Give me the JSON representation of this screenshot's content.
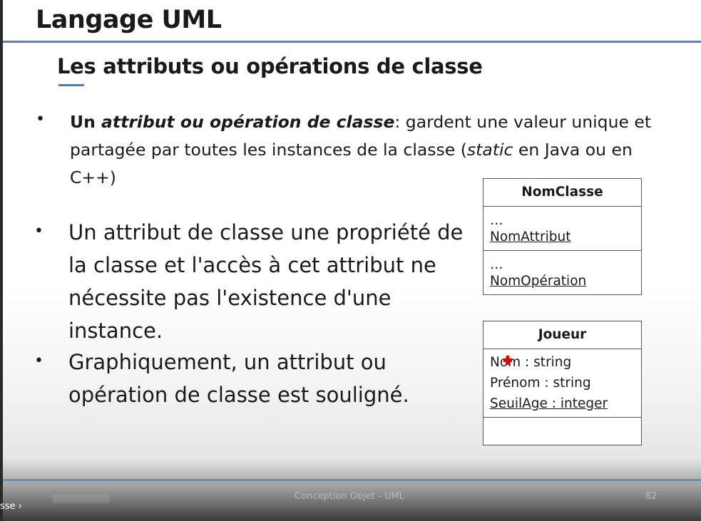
{
  "slide": {
    "title": "Langage UML",
    "subtitle": "Les attributs ou opérations de classe",
    "bullet_glyph": "•",
    "bullet1": {
      "bold_start": "Un ",
      "bold_italic": "attribut ou opération de classe",
      "rest_a": ": gardent une valeur unique et partagée par toutes les instances de la classe (",
      "italic": "static",
      "rest_b": " en Java ou en C++)"
    },
    "bullet2": "Un attribut de classe une propriété de la classe et l'accès à cet attribut ne nécessite pas l'existence d'une instance.",
    "bullet3": "Graphiquement, un attribut ou opération de classe est souligné."
  },
  "uml_nomclasse": {
    "name": "NomClasse",
    "attr_ellipsis": "…",
    "attribute": "NomAttribut",
    "op_ellipsis": "…",
    "operation": "NomOpération"
  },
  "uml_joueur": {
    "name": "Joueur",
    "attributes": [
      "Nom : string",
      "Prénom : string",
      "SeuilAge : integer"
    ]
  },
  "footer": {
    "center": "Conception Objet - UML",
    "page": "82"
  },
  "player": {
    "chapter_label": "sse ›"
  },
  "colors": {
    "accent_rule": "#5f7fa9",
    "subtitle_accent": "#4a7ab8",
    "cursor_marker": "#dd0000"
  },
  "icons": {
    "cursor_marker": "red-cross-cursor-icon"
  }
}
